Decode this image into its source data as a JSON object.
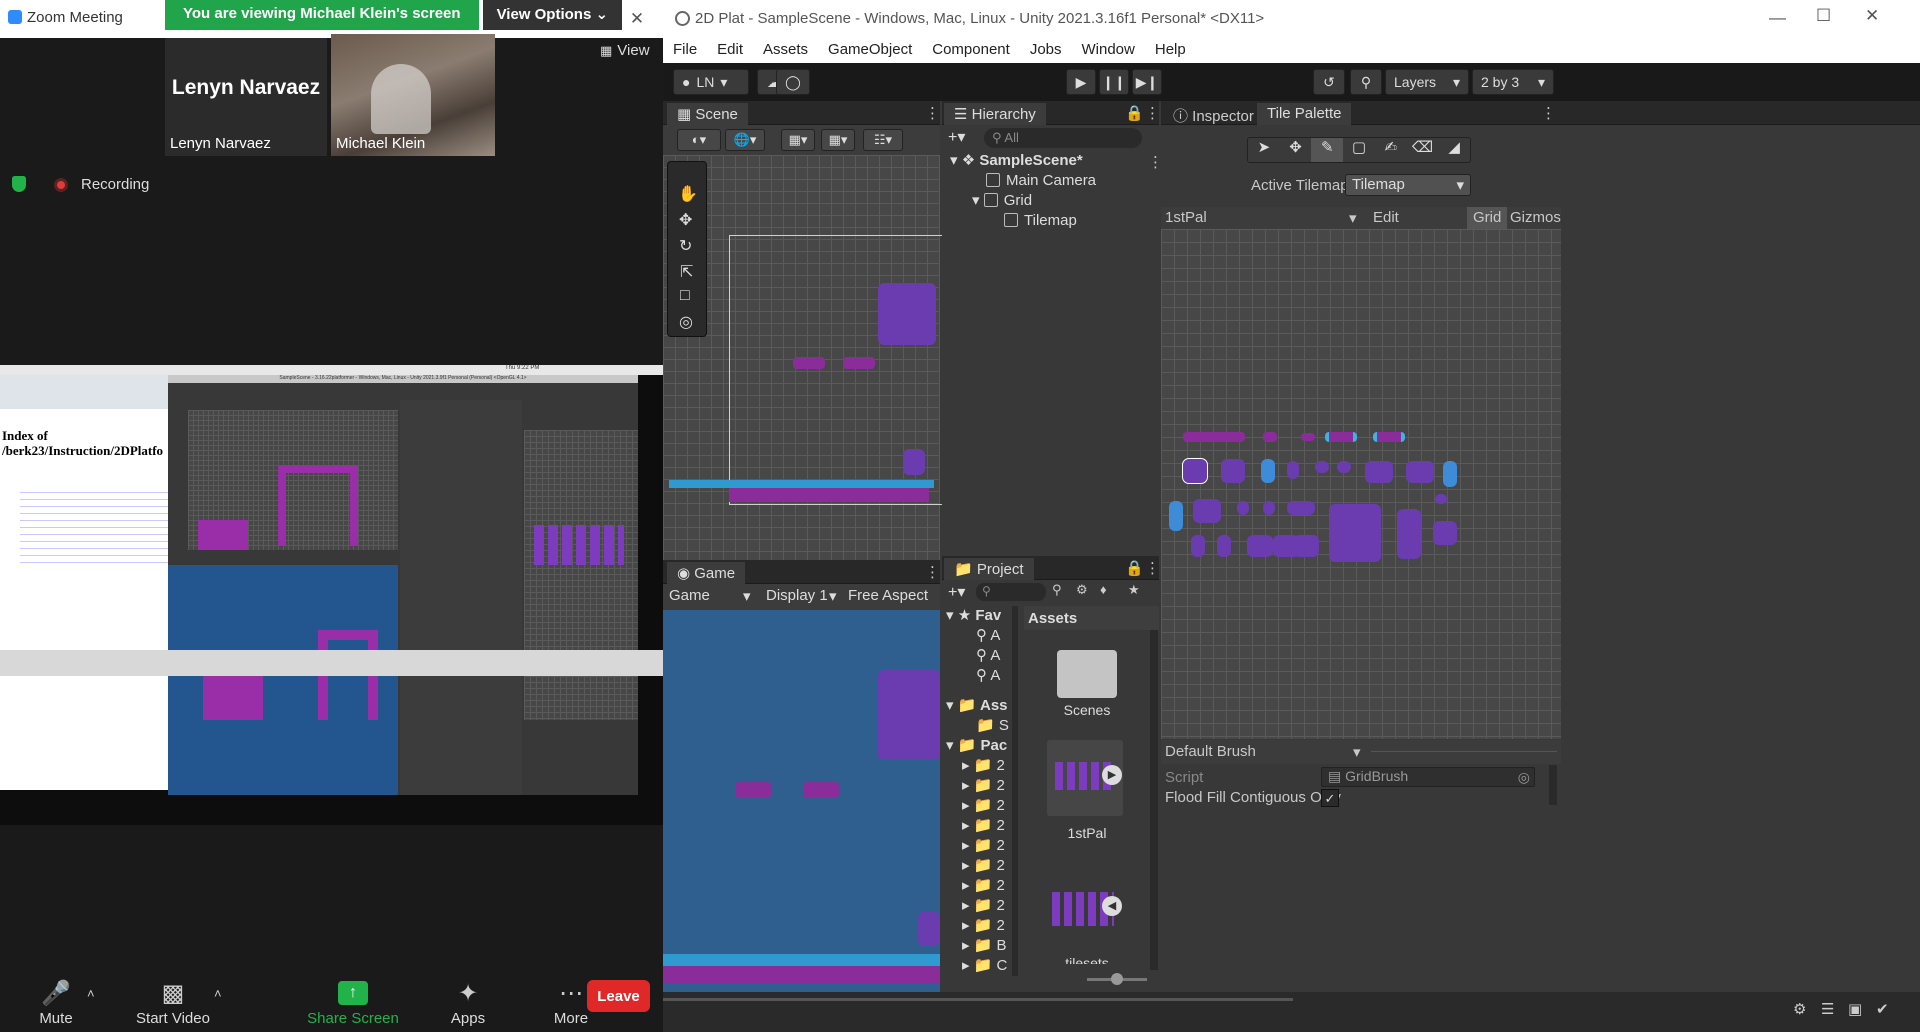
{
  "zoom": {
    "title": "Zoom Meeting",
    "banner": {
      "viewing_text": "You are viewing Michael Klein's screen",
      "view_options_label": "View Options"
    },
    "view_label": "View",
    "participants": [
      {
        "name_big": "Lenyn Narvaez",
        "name_label": "Lenyn Narvaez"
      },
      {
        "name_label": "Michael Klein"
      }
    ],
    "recording_label": "Recording",
    "shared": {
      "browser_heading_line1": "Index of",
      "browser_heading_line2": "/berk23/Instruction/2DPlatfo",
      "unity_title": "SampleScene - 3.16.22platformer - Windows, Mac, Linux - Unity 2021.3.9f1 Personal (Personal) <OpenGL 4.1>",
      "clock": "Thu 9:22 PM"
    },
    "toolbar": {
      "mute": "Mute",
      "start_video": "Start Video",
      "share_screen": "Share Screen",
      "apps": "Apps",
      "more": "More",
      "leave": "Leave"
    }
  },
  "unity": {
    "window_title": "2D Plat - SampleScene - Windows, Mac, Linux - Unity 2021.3.16f1 Personal* <DX11>",
    "menu": [
      "File",
      "Edit",
      "Assets",
      "GameObject",
      "Component",
      "Jobs",
      "Window",
      "Help"
    ],
    "toolbar": {
      "account": "LN",
      "layers": "Layers",
      "layout": "2 by 3"
    },
    "scene_tab": "Scene",
    "game_tab": "Game",
    "game_bar": {
      "display_mode": "Game",
      "display": "Display 1",
      "aspect": "Free Aspect"
    },
    "hierarchy": {
      "tab": "Hierarchy",
      "search_placeholder": "All",
      "items": [
        {
          "label": "SampleScene*",
          "depth": 0
        },
        {
          "label": "Main Camera",
          "depth": 1
        },
        {
          "label": "Grid",
          "depth": 1
        },
        {
          "label": "Tilemap",
          "depth": 2
        }
      ]
    },
    "project": {
      "tab": "Project",
      "assets_header": "Assets",
      "tree": [
        "Fav",
        "A",
        "A",
        "A",
        "Ass",
        "S",
        "Pac",
        "2",
        "2",
        "2",
        "2",
        "2",
        "2",
        "2",
        "2",
        "2",
        "B",
        "C"
      ],
      "grid_items": [
        {
          "label": "Scenes"
        },
        {
          "label": "1stPal"
        },
        {
          "label": "tilesets"
        }
      ]
    },
    "inspector_tab": "Inspector",
    "tile_palette": {
      "tab": "Tile Palette",
      "active_tilemap_label": "Active Tilemap",
      "active_tilemap_value": "Tilemap",
      "palette_name": "1stPal",
      "edit_label": "Edit",
      "grid_label": "Grid",
      "gizmos_label": "Gizmos",
      "default_brush": "Default Brush",
      "script_label": "Script",
      "script_value": "GridBrush",
      "flood_fill_label": "Flood Fill Contiguous Only"
    }
  }
}
